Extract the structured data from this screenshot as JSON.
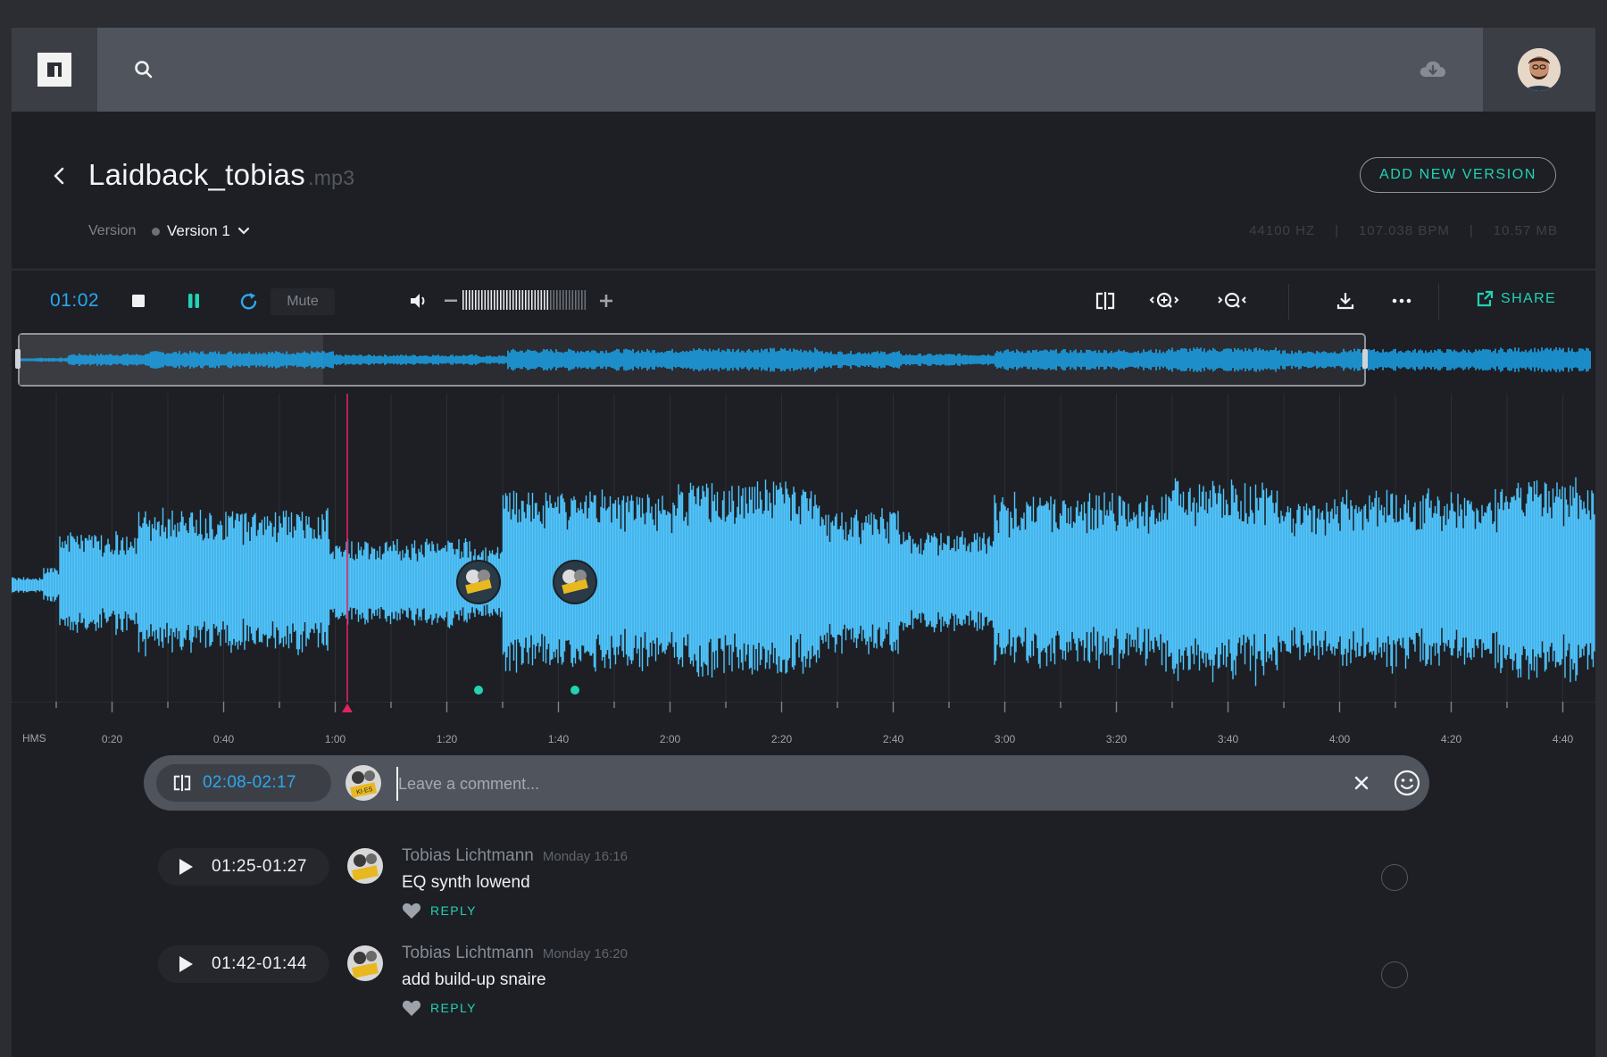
{
  "app": {
    "logo": "app-logo"
  },
  "header": {
    "title": "Laidback_tobias",
    "extension": ".mp3",
    "add_version_label": "ADD NEW VERSION",
    "version_label": "Version",
    "version_value": "Version 1",
    "meta": {
      "sample_rate": "44100 HZ",
      "bpm": "107.038 BPM",
      "size": "10.57 MB",
      "separator": "|"
    }
  },
  "toolbar": {
    "current_time": "01:02",
    "mute_label": "Mute",
    "share_label": "SHARE"
  },
  "timeline": {
    "unit_label": "HMS",
    "labels": [
      "0:20",
      "0:40",
      "1:00",
      "1:20",
      "1:40",
      "2:00",
      "2:20",
      "2:40",
      "3:00",
      "3:20",
      "3:40",
      "4:00",
      "4:20",
      "4:40"
    ]
  },
  "playback": {
    "playhead_time": "1:00"
  },
  "comment_box": {
    "range": "02:08-02:17",
    "placeholder": "Leave a comment..."
  },
  "comments": [
    {
      "range": "01:25-01:27",
      "author": "Tobias Lichtmann",
      "date": "Monday 16:16",
      "text": "EQ synth lowend",
      "reply_label": "REPLY"
    },
    {
      "range": "01:42-01:44",
      "author": "Tobias Lichtmann",
      "date": "Monday 16:20",
      "text": "add build-up snaire",
      "reply_label": "REPLY"
    }
  ],
  "colors": {
    "accent_teal": "#22d3b4",
    "accent_blue": "#2ba8ef",
    "wave": "#4fc6ff",
    "overview_wave": "#1aa7f0",
    "playhead": "#e0245e"
  }
}
